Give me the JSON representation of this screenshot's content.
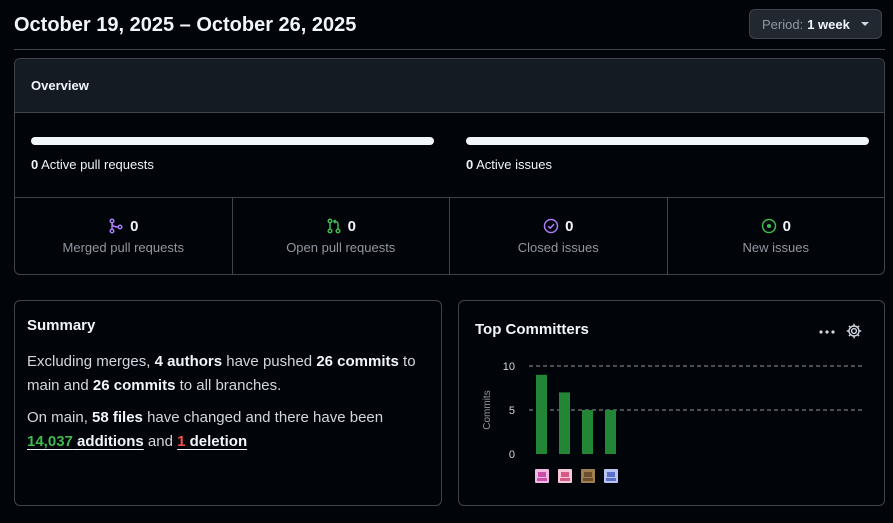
{
  "header": {
    "title": "October 19, 2025 – October 26, 2025",
    "period_label": "Period:",
    "period_value": "1 week"
  },
  "overview": {
    "title": "Overview",
    "pr": {
      "count": "0",
      "label": "Active pull requests"
    },
    "issues": {
      "count": "0",
      "label": "Active issues"
    },
    "stats": [
      {
        "value": "0",
        "label": "Merged pull requests",
        "icon": "merge-icon",
        "color": "#ab7df8"
      },
      {
        "value": "0",
        "label": "Open pull requests",
        "icon": "pull-request-icon",
        "color": "#3fb950"
      },
      {
        "value": "0",
        "label": "Closed issues",
        "icon": "issue-closed-icon",
        "color": "#ab7df8"
      },
      {
        "value": "0",
        "label": "New issues",
        "icon": "issue-opened-icon",
        "color": "#3fb950"
      }
    ]
  },
  "summary": {
    "title": "Summary",
    "p1": {
      "t1": "Excluding merges, ",
      "authors": "4 authors",
      "t2": " have pushed ",
      "commits_main": "26 commits",
      "t3": " to main and ",
      "commits_all": "26 commits",
      "t4": " to all branches."
    },
    "p2": {
      "t1": "On main, ",
      "files": "58 files",
      "t2": " have changed and there have been",
      "additions_num": "14,037",
      "additions_word": " additions",
      "t3": " and ",
      "deletions_num": "1",
      "deletions_word": " deletion"
    }
  },
  "committers": {
    "title": "Top Committers",
    "bar_color": "#238636",
    "chart_data": {
      "type": "bar",
      "ylabel": "Commits",
      "ylim": [
        0,
        10
      ],
      "yticks": [
        0,
        5,
        10
      ],
      "values": [
        9,
        7,
        5,
        5
      ]
    }
  }
}
